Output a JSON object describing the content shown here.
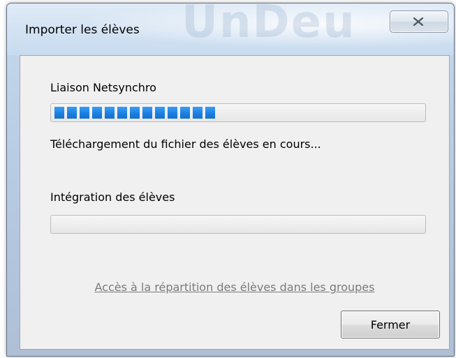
{
  "window": {
    "title": "Importer les élèves",
    "watermark_text": "UnDeu"
  },
  "section1": {
    "title": "Liaison Netsynchro",
    "progress": 0.43,
    "progress_segments": 13,
    "status": "Téléchargement du fichier des élèves en cours..."
  },
  "section2": {
    "title": "Intégration des élèves",
    "progress": 0
  },
  "link": {
    "label": "Accès à la répartition des élèves dans les groupes"
  },
  "footer": {
    "close_label": "Fermer"
  },
  "colors": {
    "progress_fill": "#1a7ee0",
    "link_disabled": "#7a7a7a"
  },
  "icons": {
    "close": "close-icon"
  }
}
